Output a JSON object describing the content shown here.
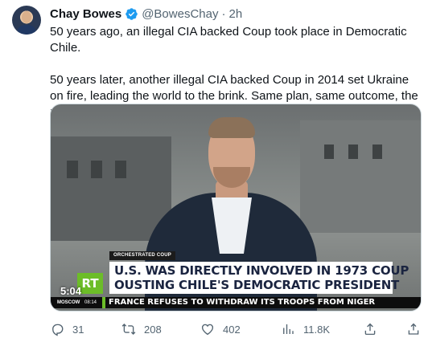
{
  "user": {
    "name": "Chay Bowes",
    "handle": "@BowesChay",
    "separator": "·",
    "time": "2h"
  },
  "tweet": {
    "paragraph_1": "50 years ago, an illegal CIA backed Coup took place in Democratic Chile.",
    "paragraph_2": "50 years later, another illegal CIA backed Coup in 2014 set Ukraine on fire, leading the world to the brink. Same plan, same outcome, the regime change playbook hasn't changed in half a century.."
  },
  "media": {
    "tag": "ORCHESTRATED COUP",
    "headline_line1": "U.S. WAS DIRECTLY INVOLVED IN 1973 COUP",
    "headline_line2": "OUSTING CHILE'S DEMOCRATIC PRESIDENT",
    "logo": "RT",
    "clock": "5:04",
    "ticker_location": "MOSCOW",
    "ticker_time": "08:14",
    "ticker_text": "FRANCE REFUSES TO WITHDRAW ITS TROOPS FROM NIGER"
  },
  "actions": {
    "replies": "31",
    "reposts": "208",
    "likes": "402",
    "views": "11.8K"
  },
  "colors": {
    "text": "#0f1419",
    "secondary": "#536471",
    "verified": "#1d9bf0",
    "rt_green": "#6cbd28",
    "headline_text": "#1a2440"
  },
  "icons": [
    "verified-badge-icon",
    "reply-icon",
    "repost-icon",
    "like-icon",
    "views-icon",
    "bookmark-icon",
    "share-icon"
  ]
}
